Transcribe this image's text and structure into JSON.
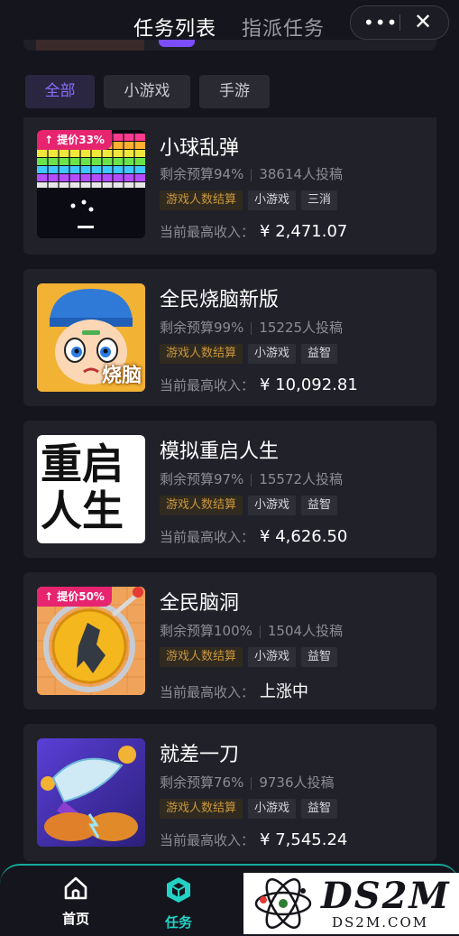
{
  "header": {
    "tab_active": "任务列表",
    "tab_inactive": "指派任务",
    "more_icon": "more-dots-icon",
    "close_icon": "close-icon"
  },
  "filters": [
    {
      "label": "全部",
      "active": true
    },
    {
      "label": "小游戏",
      "active": false
    },
    {
      "label": "手游",
      "active": false
    }
  ],
  "income_label": "当前最高收入：",
  "tasks": [
    {
      "title": "小球乱弹",
      "badge": "↑ 提价33%",
      "budget": "剩余预算94%",
      "submissions": "38614人投稿",
      "tags": [
        "游戏人数结算",
        "小游戏",
        "三消"
      ],
      "income": "¥ 2,471.07"
    },
    {
      "title": "全民烧脑新版",
      "badge": "",
      "budget": "剩余预算99%",
      "submissions": "15225人投稿",
      "tags": [
        "游戏人数结算",
        "小游戏",
        "益智"
      ],
      "income": "¥ 10,092.81",
      "thumb_text": "烧脑"
    },
    {
      "title": "模拟重启人生",
      "badge": "",
      "budget": "剩余预算97%",
      "submissions": "15572人投稿",
      "tags": [
        "游戏人数结算",
        "小游戏",
        "益智"
      ],
      "income": "¥ 4,626.50",
      "thumb_text": [
        "重启",
        "人生"
      ]
    },
    {
      "title": "全民脑洞",
      "badge": "↑ 提价50%",
      "budget": "剩余预算100%",
      "submissions": "1504人投稿",
      "tags": [
        "游戏人数结算",
        "小游戏",
        "益智"
      ],
      "income": "上涨中"
    },
    {
      "title": "就差一刀",
      "badge": "",
      "budget": "剩余预算76%",
      "submissions": "9736人投稿",
      "tags": [
        "游戏人数结算",
        "小游戏",
        "益智"
      ],
      "income": "¥ 7,545.24"
    }
  ],
  "bottom_nav": [
    {
      "label": "首页",
      "icon": "home-icon"
    },
    {
      "label": "任务",
      "icon": "task-cube-icon"
    }
  ],
  "watermark": {
    "big": "DS2M",
    "small": "DS2M.COM"
  },
  "colors": {
    "accent": "#8b6dff",
    "teal": "#22d3c5",
    "badge": "#e6246f",
    "gold_tag": "#c9973c"
  }
}
